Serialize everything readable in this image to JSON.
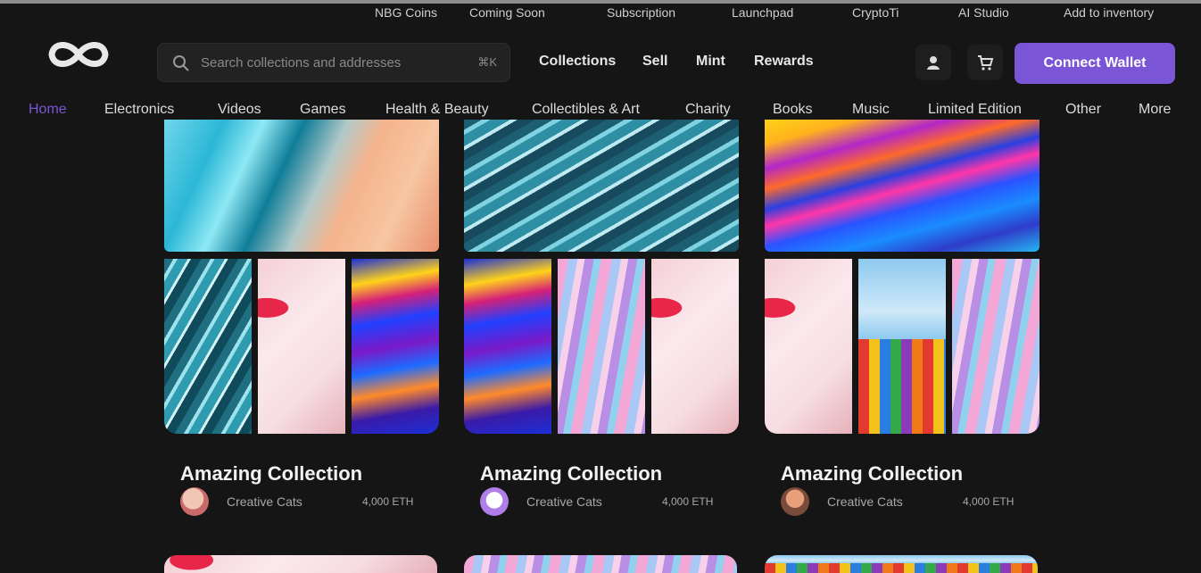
{
  "util_nav": [
    "NBG Coins",
    "Coming Soon",
    "Subscription",
    "Launchpad",
    "CryptoTi",
    "AI Studio",
    "Add to inventory"
  ],
  "search": {
    "placeholder": "Search collections and addresses",
    "shortcut": "⌘K"
  },
  "main_nav": [
    "Collections",
    "Sell",
    "Mint",
    "Rewards"
  ],
  "header_actions": {
    "connect_label": "Connect Wallet"
  },
  "categories": [
    {
      "label": "Home",
      "active": true
    },
    {
      "label": "Electronics"
    },
    {
      "label": "Videos"
    },
    {
      "label": "Games"
    },
    {
      "label": "Health & Beauty"
    },
    {
      "label": "Collectibles & Art"
    },
    {
      "label": "Charity"
    },
    {
      "label": "Books"
    },
    {
      "label": "Music"
    },
    {
      "label": "Limited Edition"
    },
    {
      "label": "Other"
    },
    {
      "label": "More"
    }
  ],
  "cards": [
    {
      "title": "Amazing Collection",
      "creator": "Creative Cats",
      "count": "4,000 ETH"
    },
    {
      "title": "Amazing Collection",
      "creator": "Creative Cats",
      "count": "4,000 ETH"
    },
    {
      "title": "Amazing Collection",
      "creator": "Creative Cats",
      "count": "4,000 ETH"
    }
  ],
  "colors": {
    "accent": "#7a55d6",
    "background": "#151515"
  }
}
